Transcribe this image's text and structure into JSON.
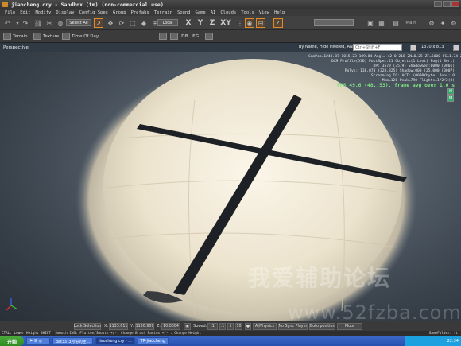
{
  "window": {
    "title": "jiaocheng.cry - Sandbox (tm) (non-commercial use)"
  },
  "menu": [
    "File",
    "Edit",
    "Modify",
    "Display",
    "Config Spec",
    "Group",
    "Prefabs",
    "Terrain",
    "Sound",
    "Game",
    "AI",
    "Clouds",
    "Tools",
    "View",
    "Help"
  ],
  "toolbar": {
    "select_filter": "Select All",
    "coord_system": "Local",
    "axes": [
      "X",
      "Y",
      "Z",
      "XY"
    ],
    "main_label": "Main"
  },
  "toolbar2": {
    "terrain": "Terrain",
    "texture": "Texture",
    "time_of_day": "Time Of Day"
  },
  "viewport": {
    "name": "Perspective",
    "filter_label": "By Name, Hide Filtered, AND",
    "search_placeholder": "Ctrl+Shift+F",
    "resolution": "1370 x 813",
    "side_h": "H",
    "side_m": "M",
    "stats": [
      "CamPos=1240.87 1015.23 109.84 Angl=-42  0 218 ZN=0.25 ZF=5000 FC=1.74 Zoom=1.00 Speed=1.07",
      "DX9 Profile(D3D)   PostSpec:21 Objects(1 Lent) Fog(1 Sort)",
      "DP: 3579 (3579) ShadowGen:0000 (0001)",
      "Polys: 138,073 (328,825) Shadow:000 (25,000 (0007)",
      "Streaming IO: ACT: (0000Kbyte) Jobs: 0",
      "Mem=126 Peak=790 Flights=1/2/2(0)"
    ],
    "fps": "FPS 49.6 (48..53), frame avg over 1.0 s",
    "watermark": "我爱辅助论坛",
    "watermark2": "www.52fzba.com"
  },
  "statusbar": {
    "lock_selection": "Lock Selection",
    "x_label": "X:",
    "x_value": "1133.611",
    "y_label": "Y:",
    "y_value": "1136.909",
    "z_label": "Z:",
    "z_value": "10.0004",
    "speed_label": "Speed:",
    "speed_value": ".1",
    "speed_1": ".1",
    "speed_10": "1",
    "speed_100": "10",
    "ai_physics": "AI/Physics",
    "no_sync": "No Sync Player",
    "goto": "Goto position",
    "mute": "Mute"
  },
  "hint": {
    "text": "CTRL: Lower Height  SHIFT: Smooth  INS: Flatten/Smooth  +/-: Change Brush Radius  +/- : Change Height",
    "right": "GameFolder: (t"
  },
  "taskbar": {
    "start": "开始",
    "tasks": [
      "bat33_3月份的主...",
      "jiaocheng.cry - ...",
      "TR-jiaocheng"
    ],
    "clock": "22:34"
  },
  "colors": {
    "accent": "#e08a2a",
    "fps": "#7fe07f",
    "taskbar": "#2650b0"
  }
}
